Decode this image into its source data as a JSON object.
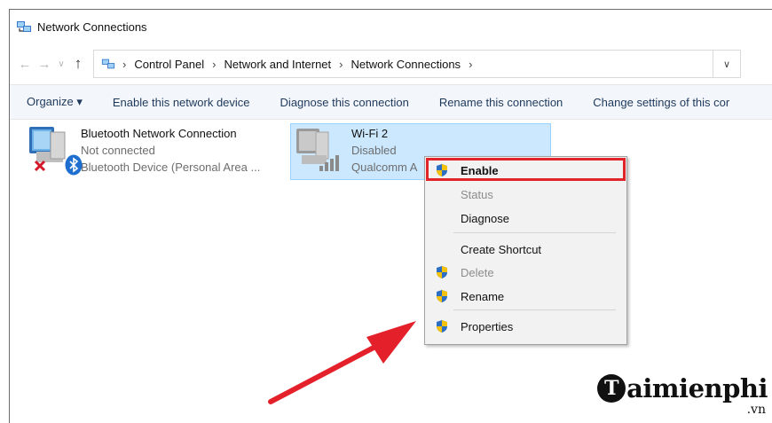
{
  "window": {
    "title": "Network Connections"
  },
  "address_bar": {
    "crumbs": [
      "Control Panel",
      "Network and Internet",
      "Network Connections"
    ]
  },
  "command_bar": {
    "organize": "Organize ▾",
    "enable": "Enable this network device",
    "diagnose": "Diagnose this connection",
    "rename": "Rename this connection",
    "change": "Change settings of this cor"
  },
  "connections": [
    {
      "name": "Bluetooth Network Connection",
      "status": "Not connected",
      "device": "Bluetooth Device (Personal Area ..."
    },
    {
      "name": "Wi-Fi 2",
      "status": "Disabled",
      "device": "Qualcomm A"
    }
  ],
  "context_menu": {
    "items": [
      "Enable",
      "Status",
      "Diagnose",
      "Create Shortcut",
      "Delete",
      "Rename",
      "Properties"
    ]
  },
  "watermark": {
    "brand": "aimienphi",
    "brand_initial": "T",
    "suffix": ".vn"
  },
  "colors": {
    "accent_highlight": "#e0242a",
    "selection": "#cce8ff",
    "command_text": "#1e395b"
  }
}
